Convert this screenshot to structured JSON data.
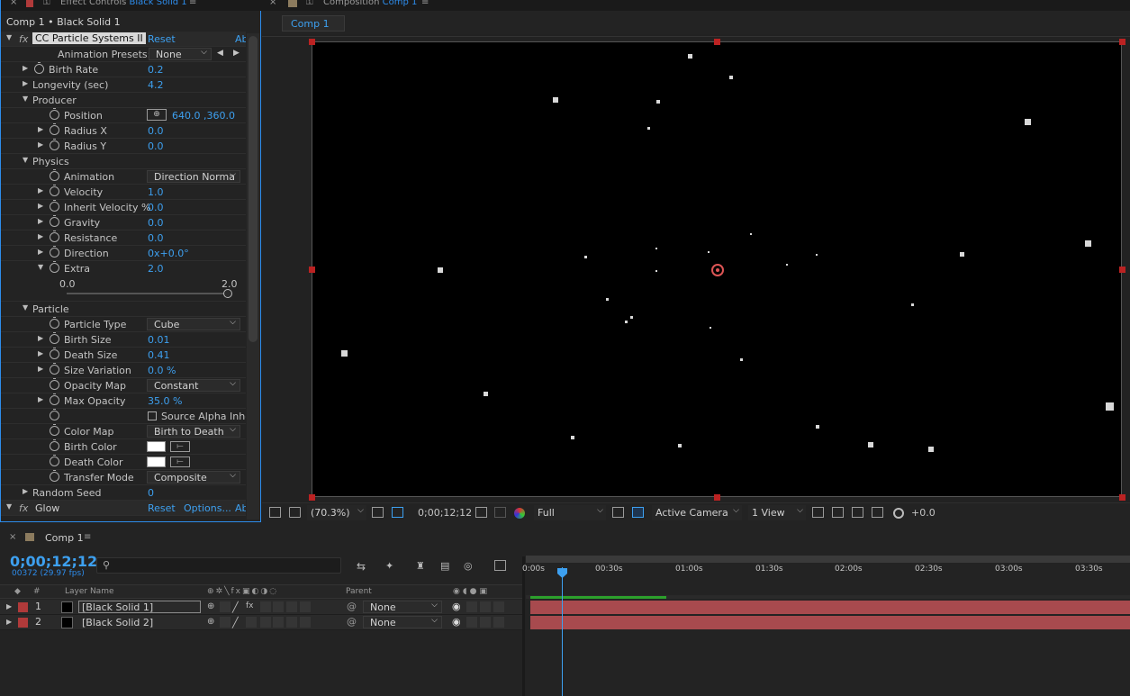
{
  "effect_controls": {
    "tab_prefix": "Effect Controls",
    "tab_layer": "Black Solid 1",
    "breadcrumb": "Comp 1 • Black Solid 1",
    "effect1": {
      "name": "CC Particle Systems II",
      "reset": "Reset",
      "about": "Ab"
    },
    "rows": {
      "presets_label": "Animation Presets:",
      "presets_value": "None",
      "birth_rate": "Birth Rate",
      "birth_rate_v": "0.2",
      "longevity": "Longevity (sec)",
      "longevity_v": "4.2",
      "producer": "Producer",
      "position": "Position",
      "position_v": "640.0 ,360.0",
      "radius_x": "Radius X",
      "radius_x_v": "0.0",
      "radius_y": "Radius Y",
      "radius_y_v": "0.0",
      "physics": "Physics",
      "animation": "Animation",
      "animation_v": "Direction Norma",
      "velocity": "Velocity",
      "velocity_v": "1.0",
      "inherit": "Inherit Velocity %",
      "inherit_v": "0.0",
      "gravity": "Gravity",
      "gravity_v": "0.0",
      "resistance": "Resistance",
      "resistance_v": "0.0",
      "direction": "Direction",
      "direction_v": "0x+0.0°",
      "extra": "Extra",
      "extra_v": "2.0",
      "slider_min": "0.0",
      "slider_max": "2.0",
      "particle": "Particle",
      "ptype": "Particle Type",
      "ptype_v": "Cube",
      "birth_size": "Birth Size",
      "birth_size_v": "0.01",
      "death_size": "Death Size",
      "death_size_v": "0.41",
      "size_var": "Size Variation",
      "size_var_v": "0.0 %",
      "opacity_map": "Opacity Map",
      "opacity_map_v": "Constant",
      "max_opacity": "Max Opacity",
      "max_opacity_v": "35.0 %",
      "source_alpha": "Source Alpha Inhe",
      "color_map": "Color Map",
      "color_map_v": "Birth to Death",
      "birth_color": "Birth Color",
      "death_color": "Death Color",
      "transfer": "Transfer Mode",
      "transfer_v": "Composite",
      "random_seed": "Random Seed",
      "random_seed_v": "0"
    },
    "effect2": {
      "name": "Glow",
      "reset": "Reset",
      "options": "Options...",
      "about": "Ab"
    }
  },
  "composition": {
    "tab_prefix": "Composition",
    "tab_name": "Comp 1",
    "comp_tab": "Comp 1"
  },
  "viewer_toolbar": {
    "zoom": "(70.3%)",
    "timecode": "0;00;12;12",
    "resolution": "Full",
    "camera": "Active Camera",
    "views": "1 View",
    "exposure": "+0.0"
  },
  "timeline": {
    "tab": "Comp 1",
    "timecode": "0;00;12;12",
    "frames": "00372 (29.97 fps)",
    "search_placeholder": "",
    "col_hash": "#",
    "col_layer_name": "Layer Name",
    "col_parent": "Parent",
    "ruler": [
      "0:00s",
      "00:30s",
      "01:00s",
      "01:30s",
      "02:00s",
      "02:30s",
      "03:00s",
      "03:30s"
    ],
    "layers": [
      {
        "num": "1",
        "name": "[Black Solid 1]",
        "parent": "None"
      },
      {
        "num": "2",
        "name": "[Black Solid 2]",
        "parent": "None"
      }
    ]
  },
  "colors": {
    "accent": "#2d8ceb",
    "label_red": "#b03a3a",
    "layer_bar": "#a84a4e"
  }
}
